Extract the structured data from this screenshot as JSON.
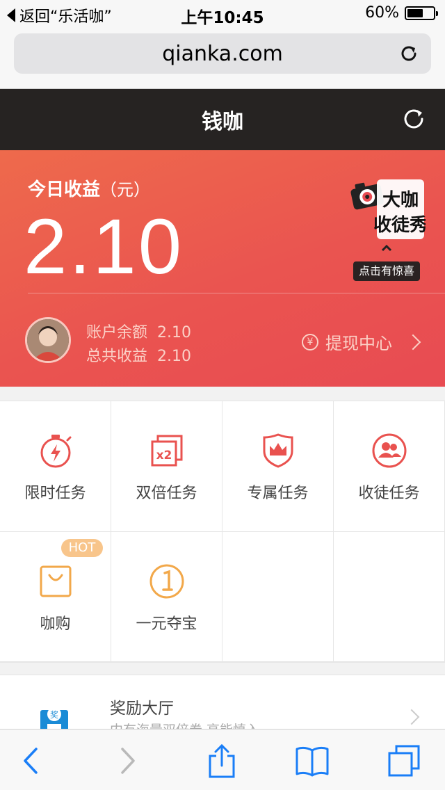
{
  "status_bar": {
    "back_text": "返回“乐活咖”",
    "time": "上午10:45",
    "battery": "60%",
    "battery_level": 0.6
  },
  "browser": {
    "url": "qianka.com"
  },
  "app": {
    "title": "钱咖"
  },
  "earnings": {
    "today_label": "今日收益",
    "unit": "（元）",
    "today_value": "2.10",
    "promo_badge": "点击有惊喜",
    "promo_logo_text": "大咖收徒秀",
    "balance_label": "账户余额",
    "balance_value": "2.10",
    "total_label": "总共收益",
    "total_value": "2.10",
    "withdraw_label": "提现中心",
    "withdraw_icon": "¥"
  },
  "tasks": [
    {
      "label": "限时任务",
      "icon": "stopwatch-icon"
    },
    {
      "label": "双倍任务",
      "icon": "double-x2-icon"
    },
    {
      "label": "专属任务",
      "icon": "crown-shield-icon"
    },
    {
      "label": "收徒任务",
      "icon": "users-icon"
    },
    {
      "label": "咖购",
      "icon": "shopping-bag-icon",
      "badge": "HOT"
    },
    {
      "label": "一元夺宝",
      "icon": "one-coin-icon"
    }
  ],
  "reward": {
    "title": "奖励大厅",
    "subtitle": "内有海量双倍券,高能慎入",
    "icon": "shop-icon"
  },
  "colors": {
    "accent": "#e9524f",
    "hot": "#f8c58b",
    "coin": "#f2a84a",
    "header": "#262322",
    "ios_blue": "#1a7ef7"
  }
}
